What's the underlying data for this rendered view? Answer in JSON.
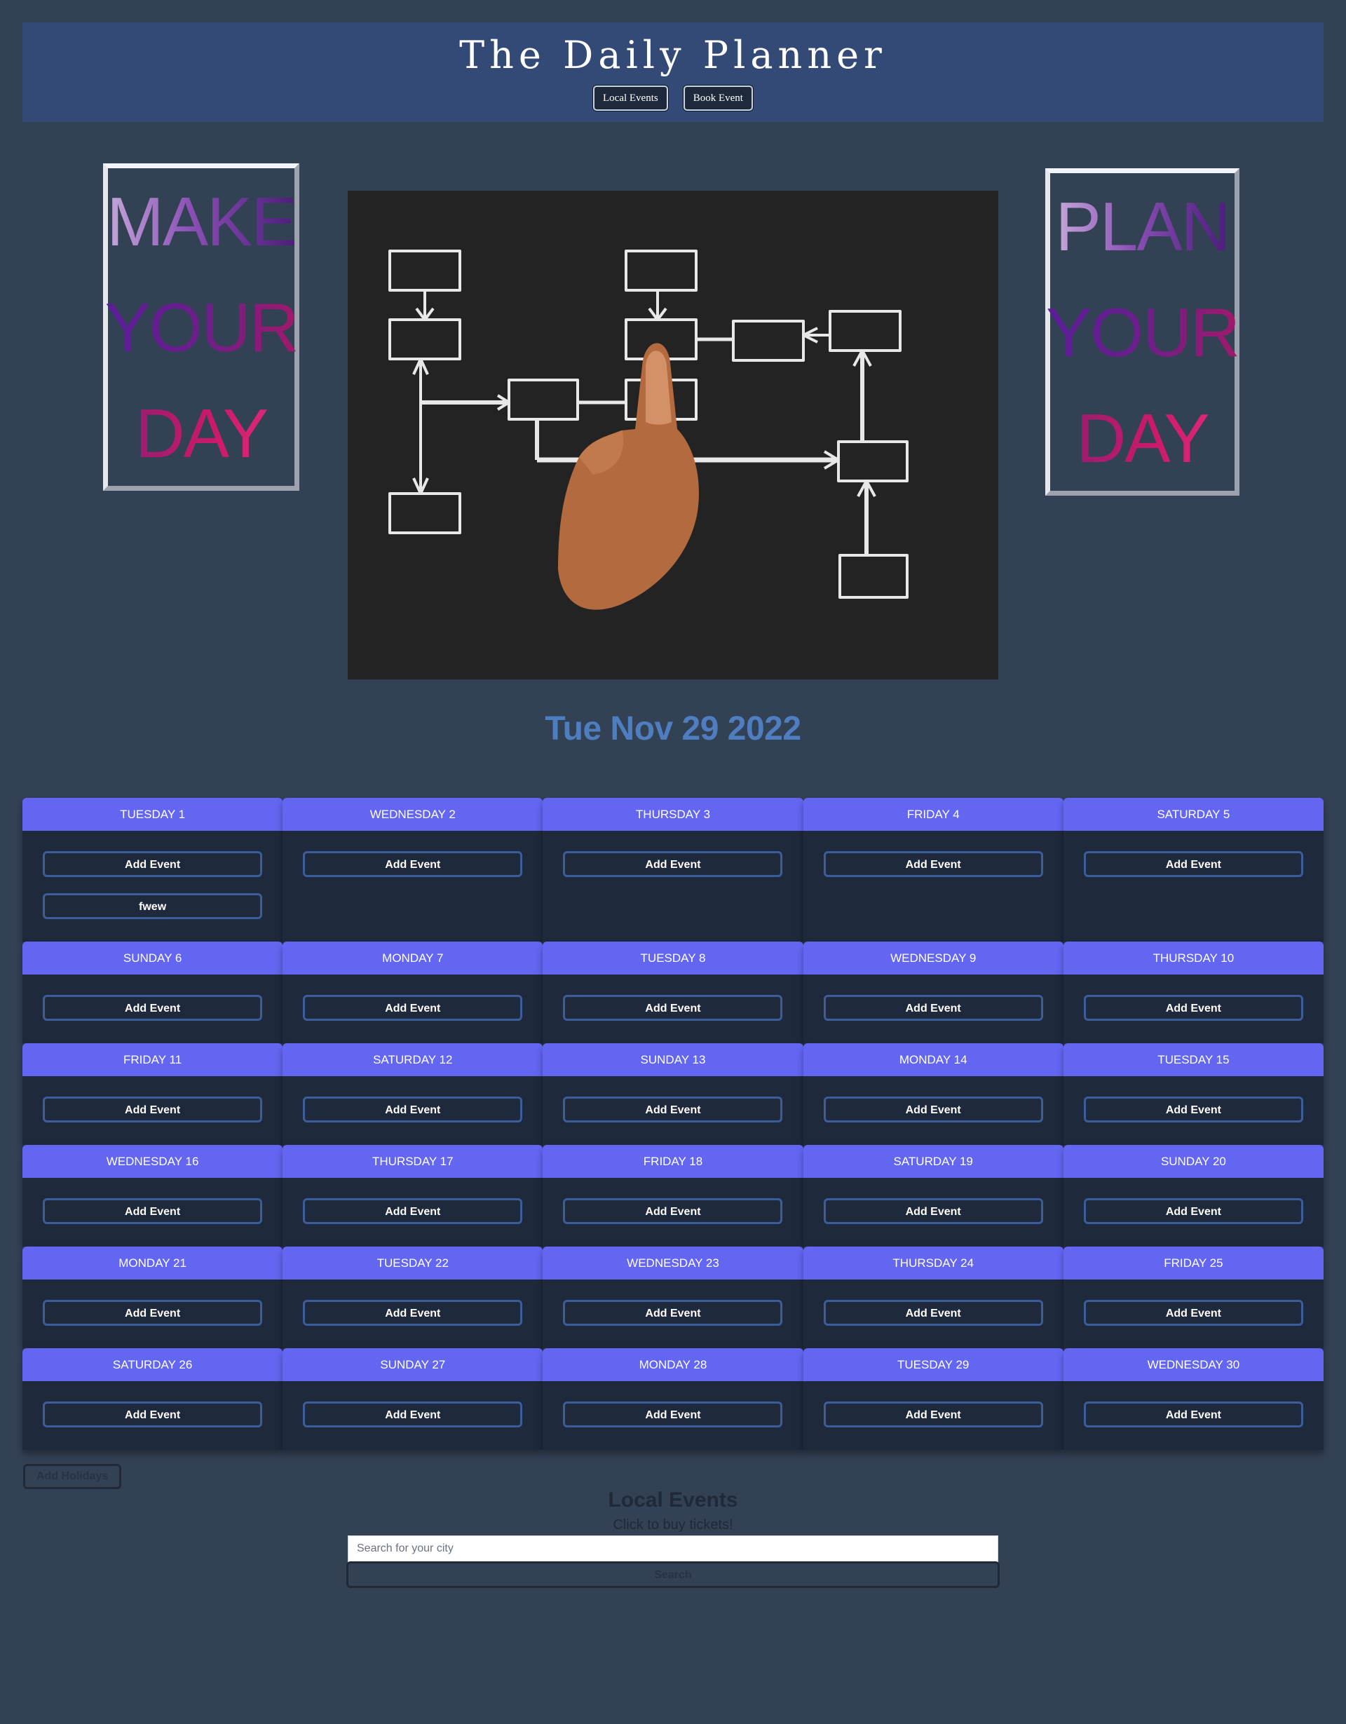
{
  "header": {
    "title": "The Daily Planner",
    "nav": [
      "Local Events",
      "Book Event"
    ]
  },
  "posters": {
    "left": [
      "MAKE",
      "YOUR",
      "DAY"
    ],
    "right": [
      "PLAN",
      "YOUR",
      "DAY"
    ]
  },
  "hero_image": {
    "icon": "flowchart-hand-image"
  },
  "current_date": "Tue Nov 29 2022",
  "calendar": {
    "add_label": "Add Event",
    "days": [
      {
        "label": "Tuesday 1",
        "events": [
          "fwew"
        ]
      },
      {
        "label": "Wednesday 2",
        "events": []
      },
      {
        "label": "Thursday 3",
        "events": []
      },
      {
        "label": "Friday 4",
        "events": []
      },
      {
        "label": "Saturday 5",
        "events": []
      },
      {
        "label": "Sunday 6",
        "events": []
      },
      {
        "label": "Monday 7",
        "events": []
      },
      {
        "label": "Tuesday 8",
        "events": []
      },
      {
        "label": "Wednesday 9",
        "events": []
      },
      {
        "label": "Thursday 10",
        "events": []
      },
      {
        "label": "Friday 11",
        "events": []
      },
      {
        "label": "Saturday 12",
        "events": []
      },
      {
        "label": "Sunday 13",
        "events": []
      },
      {
        "label": "Monday 14",
        "events": []
      },
      {
        "label": "Tuesday 15",
        "events": []
      },
      {
        "label": "Wednesday 16",
        "events": []
      },
      {
        "label": "Thursday 17",
        "events": []
      },
      {
        "label": "Friday 18",
        "events": []
      },
      {
        "label": "Saturday 19",
        "events": []
      },
      {
        "label": "Sunday 20",
        "events": []
      },
      {
        "label": "Monday 21",
        "events": []
      },
      {
        "label": "Tuesday 22",
        "events": []
      },
      {
        "label": "Wednesday 23",
        "events": []
      },
      {
        "label": "Thursday 24",
        "events": []
      },
      {
        "label": "Friday 25",
        "events": []
      },
      {
        "label": "Saturday 26",
        "events": []
      },
      {
        "label": "Sunday 27",
        "events": []
      },
      {
        "label": "Monday 28",
        "events": []
      },
      {
        "label": "Tuesday 29",
        "events": []
      },
      {
        "label": "Wednesday 30",
        "events": []
      }
    ]
  },
  "holidays_button": "Add Holidays",
  "local_events": {
    "title": "Local Events",
    "subtitle": "Click to buy tickets!",
    "search_placeholder": "Search for your city",
    "search_value": "",
    "search_button": "Search"
  },
  "colors": {
    "page_bg": "#334155",
    "header_bg": "#344a76",
    "day_header": "#6366f1",
    "day_body": "#1e293b",
    "date_text": "#4f7ec0"
  }
}
